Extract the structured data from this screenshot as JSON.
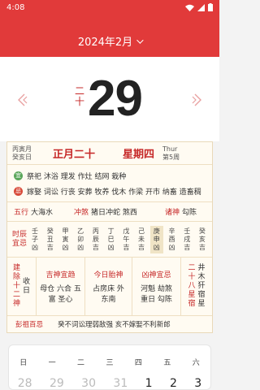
{
  "status": {
    "time": "4:08"
  },
  "header": {
    "month": "2024年2月"
  },
  "date": {
    "lunar_day_vertical": "二十",
    "day": "29"
  },
  "info": {
    "ganzhi_year": "丙寅月",
    "ganzhi_day": "癸亥日",
    "lunar_date": "正月二十",
    "weekday": "星期四",
    "weekday_en": "Thur",
    "week_no": "第5周"
  },
  "yiji": {
    "yi_badge": "宜",
    "yi_text": "祭祀 沐浴 理发 作灶 结网 栽种",
    "ji_badge": "忌",
    "ji_text": "嫁娶 词讼 行丧 安葬 牧养 伐木 作梁 开市 纳畜 造畜稠"
  },
  "row3": {
    "wuxing_label": "五行",
    "wuxing_value": "大海水",
    "chong_label": "冲煞",
    "chong_value": "猪日冲蛇 煞西",
    "zhushen_label": "诸神",
    "zhushen_value": "勾陈"
  },
  "hours": {
    "label": "时辰宜忌",
    "items": [
      {
        "line1": "壬",
        "line2": "子",
        "line3": "凶"
      },
      {
        "line1": "癸",
        "line2": "丑",
        "line3": "吉"
      },
      {
        "line1": "甲",
        "line2": "寅",
        "line3": "凶"
      },
      {
        "line1": "乙",
        "line2": "卯",
        "line3": "凶"
      },
      {
        "line1": "丙",
        "line2": "辰",
        "line3": "吉"
      },
      {
        "line1": "丁",
        "line2": "巳",
        "line3": "凶"
      },
      {
        "line1": "戊",
        "line2": "午",
        "line3": "吉"
      },
      {
        "line1": "己",
        "line2": "未",
        "line3": "吉"
      },
      {
        "line1": "庚",
        "line2": "申",
        "line3": "凶"
      },
      {
        "line1": "辛",
        "line2": "酉",
        "line3": "凶"
      },
      {
        "line1": "壬",
        "line2": "戌",
        "line3": "吉"
      },
      {
        "line1": "癸",
        "line2": "亥",
        "line3": "吉"
      }
    ]
  },
  "row5": {
    "jianchu_label": "建除十二神",
    "jianchu_value": "收日",
    "jishen_label": "吉神宜趋",
    "jishen_line1": "母仓 六合 五",
    "jishen_line2": "富 圣心",
    "taishen_label": "今日胎神",
    "taishen_line1": "占房床 外",
    "taishen_line2": "东南",
    "xiongshen_label": "凶神宜忌",
    "xiongshen_line1": "河魁 劫煞",
    "xiongshen_line2": "重日 勾陈",
    "xiu_label": "二十八星宿",
    "xiu_value": "井木犴宿星"
  },
  "pengzu": {
    "label": "彭祖百忌",
    "value": "癸不词讼理弱敌强 亥不嫁娶不利新郎"
  },
  "mini_calendar": {
    "weekdays": [
      "日",
      "一",
      "二",
      "三",
      "四",
      "五",
      "六"
    ],
    "days": [
      "28",
      "29",
      "30",
      "31",
      "1",
      "2",
      "3"
    ]
  },
  "colors": {
    "brand_red": "#e13a3a",
    "panel_bg": "#fffbf2"
  }
}
